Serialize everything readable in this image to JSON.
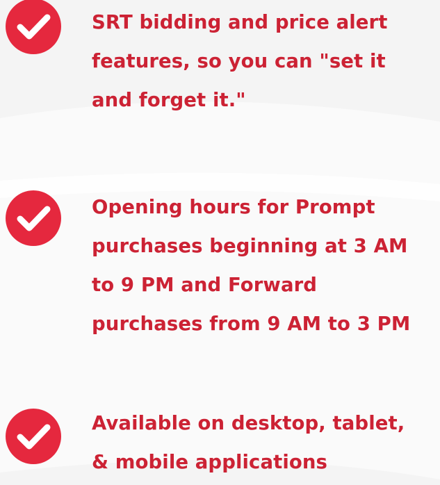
{
  "colors": {
    "accent": "#e5283e",
    "text": "#cc2234",
    "background": "#f4f4f4"
  },
  "features": [
    {
      "icon": "check-circle-icon",
      "lines": [
        "SRT bidding and price alert",
        "features, so you can \"set it",
        "and forget it.\""
      ]
    },
    {
      "icon": "check-circle-icon",
      "lines": [
        "Opening hours for Prompt",
        "purchases beginning at 3 AM",
        "to 9 PM  and Forward",
        "purchases from 9 AM to 3 PM"
      ]
    },
    {
      "icon": "check-circle-icon",
      "lines": [
        "Available on desktop, tablet,",
        "& mobile applications"
      ]
    }
  ]
}
